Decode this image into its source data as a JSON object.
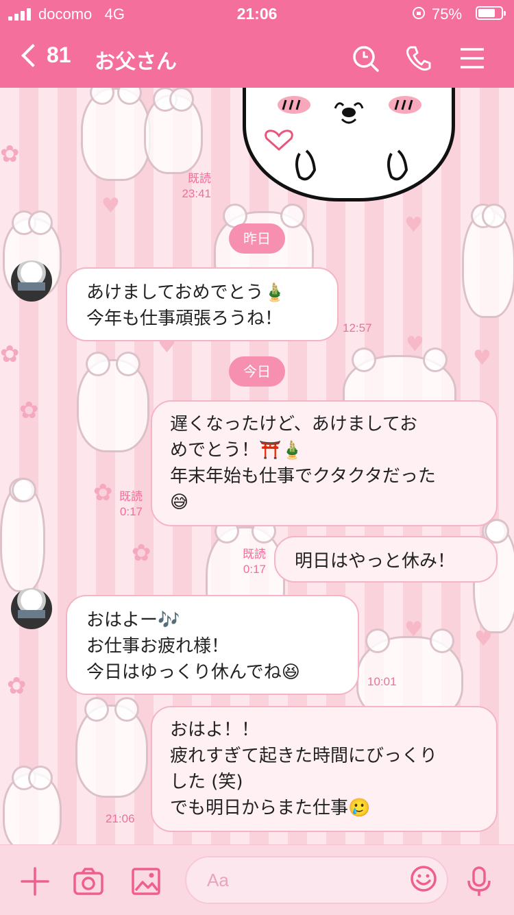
{
  "status_bar": {
    "carrier": "docomo",
    "network": "4G",
    "time": "21:06",
    "battery_percent": "75%",
    "battery_level": 0.75
  },
  "header": {
    "back_count": "81",
    "title": "お父さん",
    "icons": [
      "search-icon",
      "phone-icon",
      "menu-icon"
    ]
  },
  "colors": {
    "accent": "#f56f9c",
    "time_text": "#f06e97",
    "bubble_border": "#f4b4c6"
  },
  "messages": {
    "sticker_read": "既読",
    "sticker_time": "23:41",
    "date_yesterday": "昨日",
    "m1_text": "あけましておめでとう🎍\n今年も仕事頑張ろうね！",
    "m1_time": "12:57",
    "date_today": "今日",
    "m2_text": "遅くなったけど、あけましてお\nめでとう！⛩️🎍\n年末年始も仕事でクタクタだった\n😅",
    "m2_read": "既読",
    "m2_time": "0:17",
    "m3_text": "明日はやっと休み！",
    "m3_read": "既読",
    "m3_time": "0:17",
    "m4_text": "おはよー🎶\nお仕事お疲れ様！\n今日はゆっくり休んでね😆",
    "m4_time": "10:01",
    "m5_text": "おはよ！！\n疲れすぎて起きた時間にびっくり\nした (笑)\nでも明日からまた仕事🥲",
    "m5_time": "21:06"
  },
  "input_bar": {
    "placeholder": "Aa",
    "icons": [
      "plus-icon",
      "camera-icon",
      "image-icon",
      "smile-icon",
      "mic-icon"
    ]
  }
}
